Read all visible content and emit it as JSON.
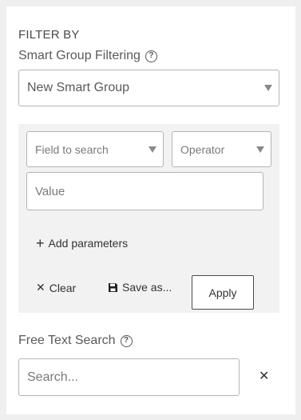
{
  "filter_by": {
    "heading": "FILTER BY"
  },
  "smart_group": {
    "label": "Smart Group Filtering",
    "help_glyph": "?",
    "selected": "New Smart Group"
  },
  "parameters": {
    "field_placeholder": "Field to search",
    "operator_placeholder": "Operator",
    "value_placeholder": "Value",
    "add_glyph": "+",
    "add_label": "Add parameters",
    "clear_glyph": "✕",
    "clear_label": "Clear",
    "save_label": "Save as...",
    "apply_label": "Apply"
  },
  "free_text": {
    "label": "Free Text Search",
    "help_glyph": "?",
    "search_placeholder": "Search...",
    "clear_glyph": "✕"
  }
}
